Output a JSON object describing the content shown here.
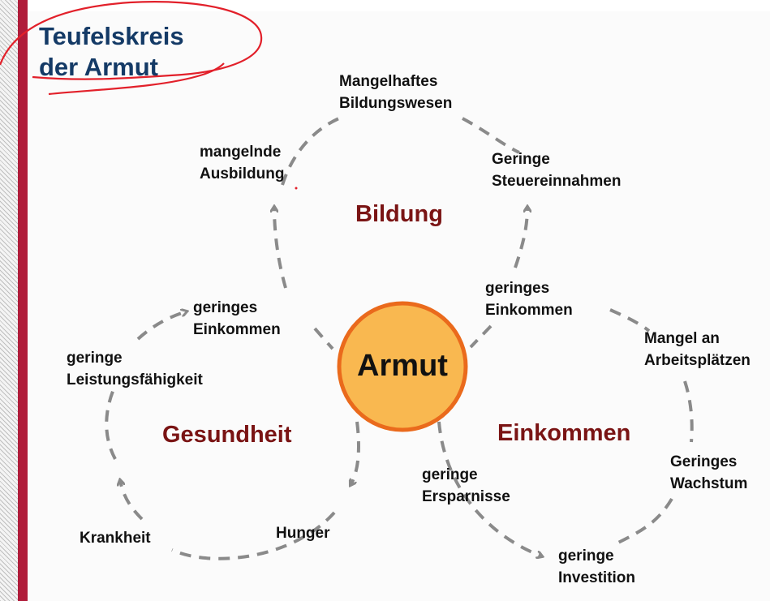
{
  "title": {
    "line1": "Teufelskreis",
    "line2": "der Armut"
  },
  "center": "Armut",
  "cycles": {
    "bildung": {
      "name": "Bildung",
      "nodes": [
        "Mangelhaftes Bildungswesen",
        "Geringe Steuereinnahmen",
        "geringes Einkommen",
        "mangelnde Ausbildung"
      ]
    },
    "gesundheit": {
      "name": "Gesundheit",
      "nodes": [
        "geringes Einkommen",
        "geringe Leistungsfähigkeit",
        "Krankheit",
        "Hunger"
      ]
    },
    "einkommen": {
      "name": "Einkommen",
      "nodes": [
        "geringes Einkommen",
        "Mangel an Arbeitsplätzen",
        "Geringes Wachstum",
        "geringe Investition",
        "geringe Ersparnisse"
      ]
    }
  },
  "labels": {
    "mangelhaftes": [
      "Mangelhaftes",
      "Bildungswesen"
    ],
    "steuer": [
      "Geringe",
      "Steuereinnahmen"
    ],
    "ausbildung": [
      "mangelnde",
      "Ausbildung"
    ],
    "einkommen_top": [
      "geringes",
      "Einkommen"
    ],
    "einkommen_left": [
      "geringes",
      "Einkommen"
    ],
    "leistung": [
      "geringe",
      "Leistungsfähigkeit"
    ],
    "krankheit": "Krankheit",
    "hunger": "Hunger",
    "mangel": [
      "Mangel an",
      "Arbeitsplätzen"
    ],
    "wachstum": [
      "Geringes",
      "Wachstum"
    ],
    "investition": [
      "geringe",
      "Investition"
    ],
    "ersparnisse": [
      "geringe",
      "Ersparnisse"
    ]
  },
  "colors": {
    "title": "#143a66",
    "section": "#7a1414",
    "circle_fill": "#f9b850",
    "circle_stroke": "#ea6a1c",
    "dash": "#8a8a8a",
    "annotation": "#e2202a",
    "accent_bar": "#b01c3a"
  }
}
